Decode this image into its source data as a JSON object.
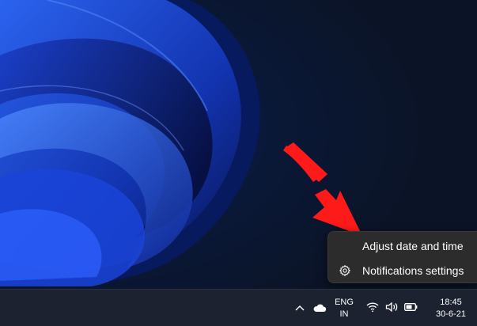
{
  "context_menu": {
    "items": [
      {
        "label": "Adjust date and time",
        "icon": "none"
      },
      {
        "label": "Notifications settings",
        "icon": "gear-icon"
      }
    ]
  },
  "taskbar": {
    "tray_icons": [
      "chevron-up-icon",
      "onedrive-cloud-icon",
      "wifi-icon",
      "volume-icon",
      "battery-icon"
    ],
    "language": {
      "line1": "ENG",
      "line2": "IN"
    },
    "clock": {
      "time": "18:45",
      "date": "30-6-21"
    }
  },
  "colors": {
    "menu_background": "#2c2c2c",
    "taskbar_background": "#1d2230",
    "annotation_arrow": "#ff1a1a",
    "wallpaper_accent": "#1f4fe0"
  }
}
